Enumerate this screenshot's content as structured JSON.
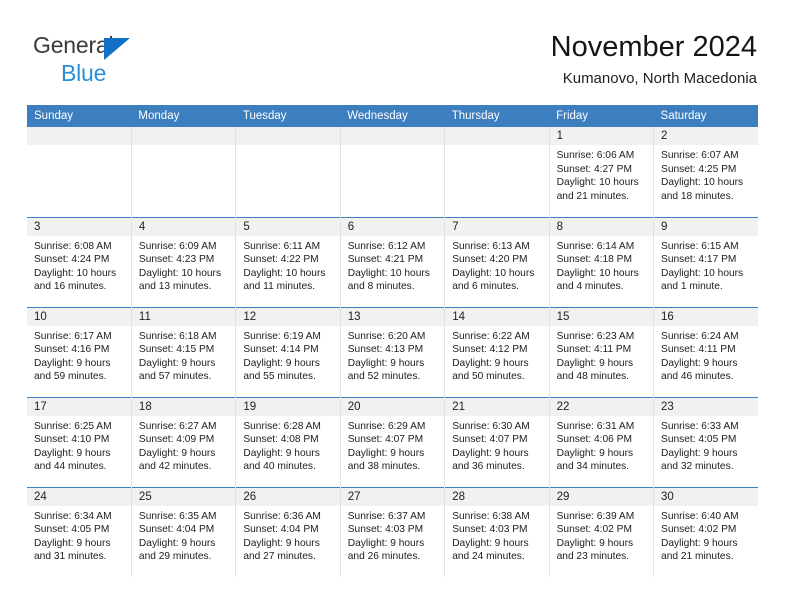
{
  "brand": {
    "word1": "General",
    "word2": "Blue",
    "triangle_color": "#1271c4",
    "word2_color": "#2a8fd8"
  },
  "header": {
    "title": "November 2024",
    "subtitle": "Kumanovo, North Macedonia"
  },
  "theme": {
    "header_blue": "#3d7ebf",
    "daynum_band": "#f1f1f1",
    "grid_line": "#e2e2e2"
  },
  "weekday_headers": [
    "Sunday",
    "Monday",
    "Tuesday",
    "Wednesday",
    "Thursday",
    "Friday",
    "Saturday"
  ],
  "weeks": [
    [
      {
        "day": "",
        "sunrise": "",
        "sunset": "",
        "daylight_line1": "",
        "daylight_line2": ""
      },
      {
        "day": "",
        "sunrise": "",
        "sunset": "",
        "daylight_line1": "",
        "daylight_line2": ""
      },
      {
        "day": "",
        "sunrise": "",
        "sunset": "",
        "daylight_line1": "",
        "daylight_line2": ""
      },
      {
        "day": "",
        "sunrise": "",
        "sunset": "",
        "daylight_line1": "",
        "daylight_line2": ""
      },
      {
        "day": "",
        "sunrise": "",
        "sunset": "",
        "daylight_line1": "",
        "daylight_line2": ""
      },
      {
        "day": "1",
        "sunrise": "Sunrise: 6:06 AM",
        "sunset": "Sunset: 4:27 PM",
        "daylight_line1": "Daylight: 10 hours",
        "daylight_line2": "and 21 minutes."
      },
      {
        "day": "2",
        "sunrise": "Sunrise: 6:07 AM",
        "sunset": "Sunset: 4:25 PM",
        "daylight_line1": "Daylight: 10 hours",
        "daylight_line2": "and 18 minutes."
      }
    ],
    [
      {
        "day": "3",
        "sunrise": "Sunrise: 6:08 AM",
        "sunset": "Sunset: 4:24 PM",
        "daylight_line1": "Daylight: 10 hours",
        "daylight_line2": "and 16 minutes."
      },
      {
        "day": "4",
        "sunrise": "Sunrise: 6:09 AM",
        "sunset": "Sunset: 4:23 PM",
        "daylight_line1": "Daylight: 10 hours",
        "daylight_line2": "and 13 minutes."
      },
      {
        "day": "5",
        "sunrise": "Sunrise: 6:11 AM",
        "sunset": "Sunset: 4:22 PM",
        "daylight_line1": "Daylight: 10 hours",
        "daylight_line2": "and 11 minutes."
      },
      {
        "day": "6",
        "sunrise": "Sunrise: 6:12 AM",
        "sunset": "Sunset: 4:21 PM",
        "daylight_line1": "Daylight: 10 hours",
        "daylight_line2": "and 8 minutes."
      },
      {
        "day": "7",
        "sunrise": "Sunrise: 6:13 AM",
        "sunset": "Sunset: 4:20 PM",
        "daylight_line1": "Daylight: 10 hours",
        "daylight_line2": "and 6 minutes."
      },
      {
        "day": "8",
        "sunrise": "Sunrise: 6:14 AM",
        "sunset": "Sunset: 4:18 PM",
        "daylight_line1": "Daylight: 10 hours",
        "daylight_line2": "and 4 minutes."
      },
      {
        "day": "9",
        "sunrise": "Sunrise: 6:15 AM",
        "sunset": "Sunset: 4:17 PM",
        "daylight_line1": "Daylight: 10 hours",
        "daylight_line2": "and 1 minute."
      }
    ],
    [
      {
        "day": "10",
        "sunrise": "Sunrise: 6:17 AM",
        "sunset": "Sunset: 4:16 PM",
        "daylight_line1": "Daylight: 9 hours",
        "daylight_line2": "and 59 minutes."
      },
      {
        "day": "11",
        "sunrise": "Sunrise: 6:18 AM",
        "sunset": "Sunset: 4:15 PM",
        "daylight_line1": "Daylight: 9 hours",
        "daylight_line2": "and 57 minutes."
      },
      {
        "day": "12",
        "sunrise": "Sunrise: 6:19 AM",
        "sunset": "Sunset: 4:14 PM",
        "daylight_line1": "Daylight: 9 hours",
        "daylight_line2": "and 55 minutes."
      },
      {
        "day": "13",
        "sunrise": "Sunrise: 6:20 AM",
        "sunset": "Sunset: 4:13 PM",
        "daylight_line1": "Daylight: 9 hours",
        "daylight_line2": "and 52 minutes."
      },
      {
        "day": "14",
        "sunrise": "Sunrise: 6:22 AM",
        "sunset": "Sunset: 4:12 PM",
        "daylight_line1": "Daylight: 9 hours",
        "daylight_line2": "and 50 minutes."
      },
      {
        "day": "15",
        "sunrise": "Sunrise: 6:23 AM",
        "sunset": "Sunset: 4:11 PM",
        "daylight_line1": "Daylight: 9 hours",
        "daylight_line2": "and 48 minutes."
      },
      {
        "day": "16",
        "sunrise": "Sunrise: 6:24 AM",
        "sunset": "Sunset: 4:11 PM",
        "daylight_line1": "Daylight: 9 hours",
        "daylight_line2": "and 46 minutes."
      }
    ],
    [
      {
        "day": "17",
        "sunrise": "Sunrise: 6:25 AM",
        "sunset": "Sunset: 4:10 PM",
        "daylight_line1": "Daylight: 9 hours",
        "daylight_line2": "and 44 minutes."
      },
      {
        "day": "18",
        "sunrise": "Sunrise: 6:27 AM",
        "sunset": "Sunset: 4:09 PM",
        "daylight_line1": "Daylight: 9 hours",
        "daylight_line2": "and 42 minutes."
      },
      {
        "day": "19",
        "sunrise": "Sunrise: 6:28 AM",
        "sunset": "Sunset: 4:08 PM",
        "daylight_line1": "Daylight: 9 hours",
        "daylight_line2": "and 40 minutes."
      },
      {
        "day": "20",
        "sunrise": "Sunrise: 6:29 AM",
        "sunset": "Sunset: 4:07 PM",
        "daylight_line1": "Daylight: 9 hours",
        "daylight_line2": "and 38 minutes."
      },
      {
        "day": "21",
        "sunrise": "Sunrise: 6:30 AM",
        "sunset": "Sunset: 4:07 PM",
        "daylight_line1": "Daylight: 9 hours",
        "daylight_line2": "and 36 minutes."
      },
      {
        "day": "22",
        "sunrise": "Sunrise: 6:31 AM",
        "sunset": "Sunset: 4:06 PM",
        "daylight_line1": "Daylight: 9 hours",
        "daylight_line2": "and 34 minutes."
      },
      {
        "day": "23",
        "sunrise": "Sunrise: 6:33 AM",
        "sunset": "Sunset: 4:05 PM",
        "daylight_line1": "Daylight: 9 hours",
        "daylight_line2": "and 32 minutes."
      }
    ],
    [
      {
        "day": "24",
        "sunrise": "Sunrise: 6:34 AM",
        "sunset": "Sunset: 4:05 PM",
        "daylight_line1": "Daylight: 9 hours",
        "daylight_line2": "and 31 minutes."
      },
      {
        "day": "25",
        "sunrise": "Sunrise: 6:35 AM",
        "sunset": "Sunset: 4:04 PM",
        "daylight_line1": "Daylight: 9 hours",
        "daylight_line2": "and 29 minutes."
      },
      {
        "day": "26",
        "sunrise": "Sunrise: 6:36 AM",
        "sunset": "Sunset: 4:04 PM",
        "daylight_line1": "Daylight: 9 hours",
        "daylight_line2": "and 27 minutes."
      },
      {
        "day": "27",
        "sunrise": "Sunrise: 6:37 AM",
        "sunset": "Sunset: 4:03 PM",
        "daylight_line1": "Daylight: 9 hours",
        "daylight_line2": "and 26 minutes."
      },
      {
        "day": "28",
        "sunrise": "Sunrise: 6:38 AM",
        "sunset": "Sunset: 4:03 PM",
        "daylight_line1": "Daylight: 9 hours",
        "daylight_line2": "and 24 minutes."
      },
      {
        "day": "29",
        "sunrise": "Sunrise: 6:39 AM",
        "sunset": "Sunset: 4:02 PM",
        "daylight_line1": "Daylight: 9 hours",
        "daylight_line2": "and 23 minutes."
      },
      {
        "day": "30",
        "sunrise": "Sunrise: 6:40 AM",
        "sunset": "Sunset: 4:02 PM",
        "daylight_line1": "Daylight: 9 hours",
        "daylight_line2": "and 21 minutes."
      }
    ]
  ]
}
